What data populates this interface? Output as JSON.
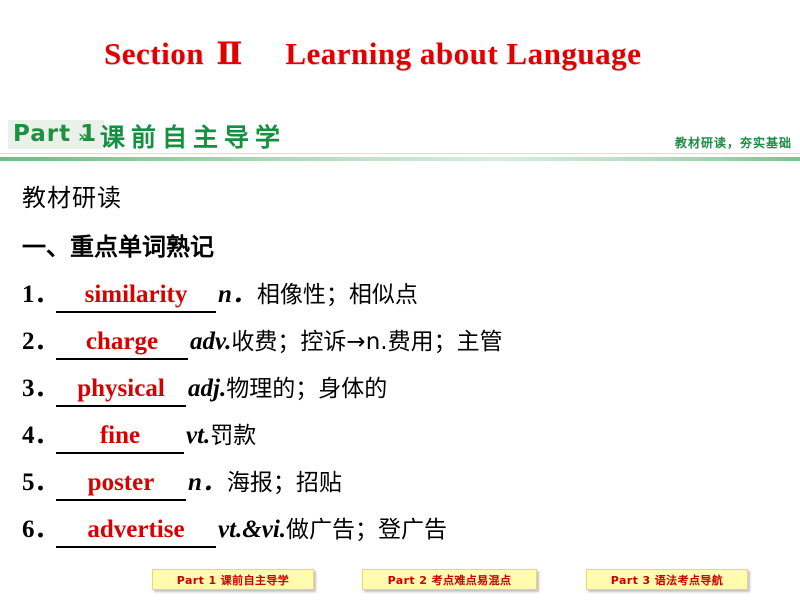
{
  "slide": {
    "title_prefix": "Section",
    "title_roman": "Ⅱ",
    "title_main": "Learning about Language"
  },
  "part_banner": {
    "chip_label": "Part 1",
    "chevron": "»",
    "part_title_cn": "课前自主导学",
    "tagline_cn": "教材研读，夯实基础",
    "accent_color": "#149040",
    "chip_bg": "#eaf1e8"
  },
  "content": {
    "heading": "教材研读",
    "subheading": "一、重点单词熟记",
    "words": [
      {
        "num": "1．",
        "answer": "similarity",
        "pos": "n．",
        "definition": "相像性；相似点"
      },
      {
        "num": "2．",
        "answer": "charge",
        "pos": "adv.",
        "definition": "收费；控诉→n.费用；主管"
      },
      {
        "num": "3．",
        "answer": "physical",
        "pos": "adj.",
        "definition": "物理的；身体的"
      },
      {
        "num": "4．",
        "answer": "fine",
        "pos": "vt.",
        "definition": "罚款"
      },
      {
        "num": "5．",
        "answer": "poster",
        "pos": "n．",
        "definition": "海报；招贴"
      },
      {
        "num": "6．",
        "answer": "advertise",
        "pos": "vt.&vi.",
        "definition": "做广告；登广告"
      }
    ],
    "answer_color": "#d80000"
  },
  "footer_nav": {
    "buttons": [
      {
        "label": "Part 1 课前自主导学"
      },
      {
        "label": "Part 2 考点难点易混点"
      },
      {
        "label": "Part 3 语法考点导航"
      }
    ],
    "button_bg": "#fffcaf",
    "button_text_color": "#cc0000"
  }
}
